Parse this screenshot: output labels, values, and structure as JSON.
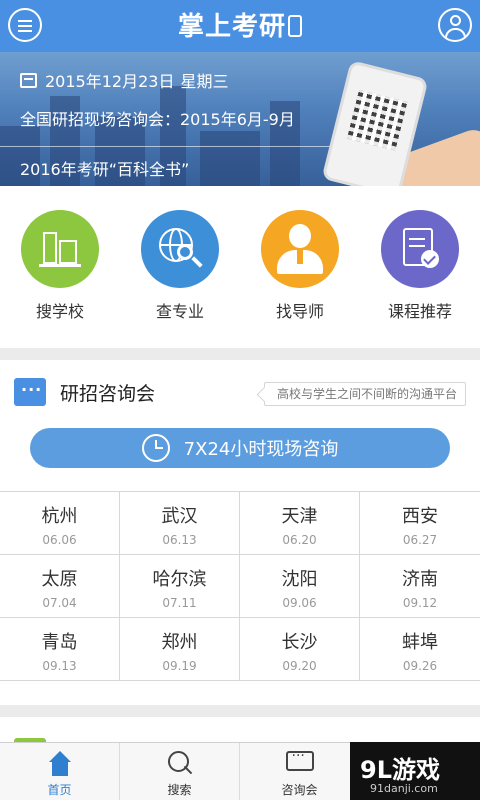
{
  "header": {
    "title": "掌上考研"
  },
  "banner": {
    "date": "2015年12月23日",
    "weekday": "星期三",
    "event": "全国研招现场咨询会：2015年6月-9月",
    "book": "2016年考研“百科全书”"
  },
  "quick_menu": [
    {
      "label": "搜学校",
      "icon": "school-building-icon",
      "color": "#8dc63f"
    },
    {
      "label": "查专业",
      "icon": "globe-search-icon",
      "color": "#3d8fd8"
    },
    {
      "label": "找导师",
      "icon": "teacher-icon",
      "color": "#f5a623"
    },
    {
      "label": "课程推荐",
      "icon": "course-check-icon",
      "color": "#6b68c9"
    }
  ],
  "section": {
    "title": "研招咨询会",
    "tagline": "高校与学生之间不间断的沟通平台",
    "button": "7X24小时现场咨询"
  },
  "cities": [
    [
      {
        "name": "杭州",
        "date": "06.06"
      },
      {
        "name": "武汉",
        "date": "06.13"
      },
      {
        "name": "天津",
        "date": "06.20"
      },
      {
        "name": "西安",
        "date": "06.27"
      }
    ],
    [
      {
        "name": "太原",
        "date": "07.04"
      },
      {
        "name": "哈尔滨",
        "date": "07.11"
      },
      {
        "name": "沈阳",
        "date": "09.06"
      },
      {
        "name": "济南",
        "date": "09.12"
      }
    ],
    [
      {
        "name": "青岛",
        "date": "09.13"
      },
      {
        "name": "郑州",
        "date": "09.19"
      },
      {
        "name": "长沙",
        "date": "09.20"
      },
      {
        "name": "蚌埠",
        "date": "09.26"
      }
    ]
  ],
  "nav": [
    {
      "label": "首页",
      "icon": "home-icon",
      "active": true
    },
    {
      "label": "搜索",
      "icon": "search-icon",
      "active": false
    },
    {
      "label": "咨询会",
      "icon": "chat-icon",
      "active": false
    }
  ],
  "watermark": {
    "main": "9L游戏",
    "sub": "91danji.com"
  },
  "colors": {
    "primary": "#4a90e2",
    "button": "#5b9ddf"
  }
}
